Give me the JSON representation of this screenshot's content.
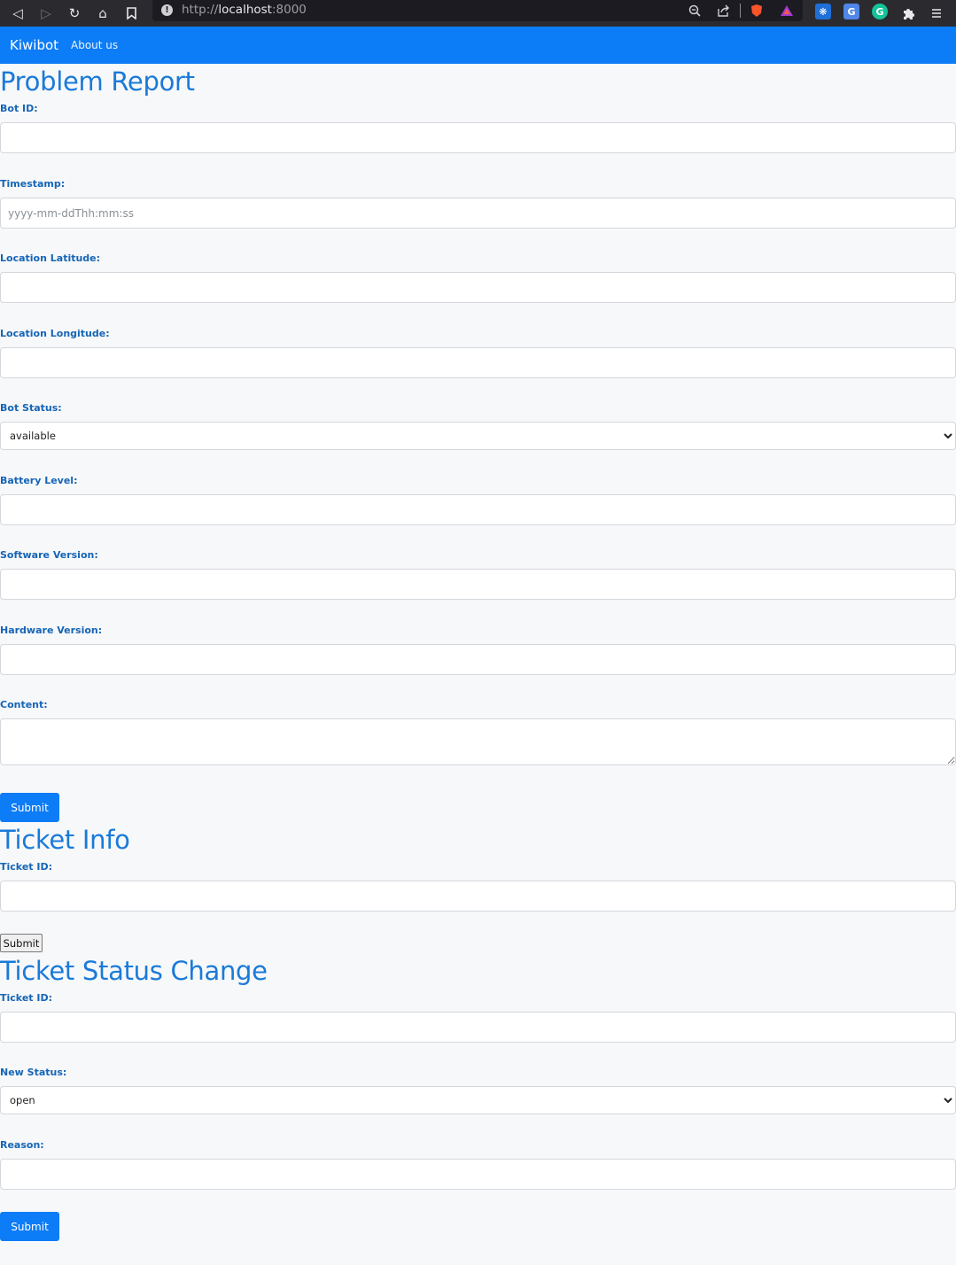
{
  "browser": {
    "url_prefix": "http://",
    "url_host": "localhost",
    "url_port": ":8000"
  },
  "navbar": {
    "brand": "Kiwibot",
    "about_link": "About us",
    "color": "#0d7cf7"
  },
  "problem_report": {
    "title": "Problem Report",
    "bot_id_label": "Bot ID:",
    "timestamp_label": "Timestamp:",
    "timestamp_placeholder": "yyyy-mm-ddThh:mm:ss",
    "latitude_label": "Location Latitude:",
    "longitude_label": "Location Longitude:",
    "bot_status_label": "Bot Status:",
    "bot_status_value": "available",
    "battery_label": "Battery Level:",
    "software_label": "Software Version:",
    "hardware_label": "Hardware Version:",
    "content_label": "Content:",
    "submit_label": "Submit"
  },
  "ticket_info": {
    "title": "Ticket Info",
    "ticket_id_label": "Ticket ID:",
    "submit_label": "Submit"
  },
  "ticket_status_change": {
    "title": "Ticket Status Change",
    "ticket_id_label": "Ticket ID:",
    "new_status_label": "New Status:",
    "new_status_value": "open",
    "reason_label": "Reason:",
    "submit_label": "Submit"
  }
}
